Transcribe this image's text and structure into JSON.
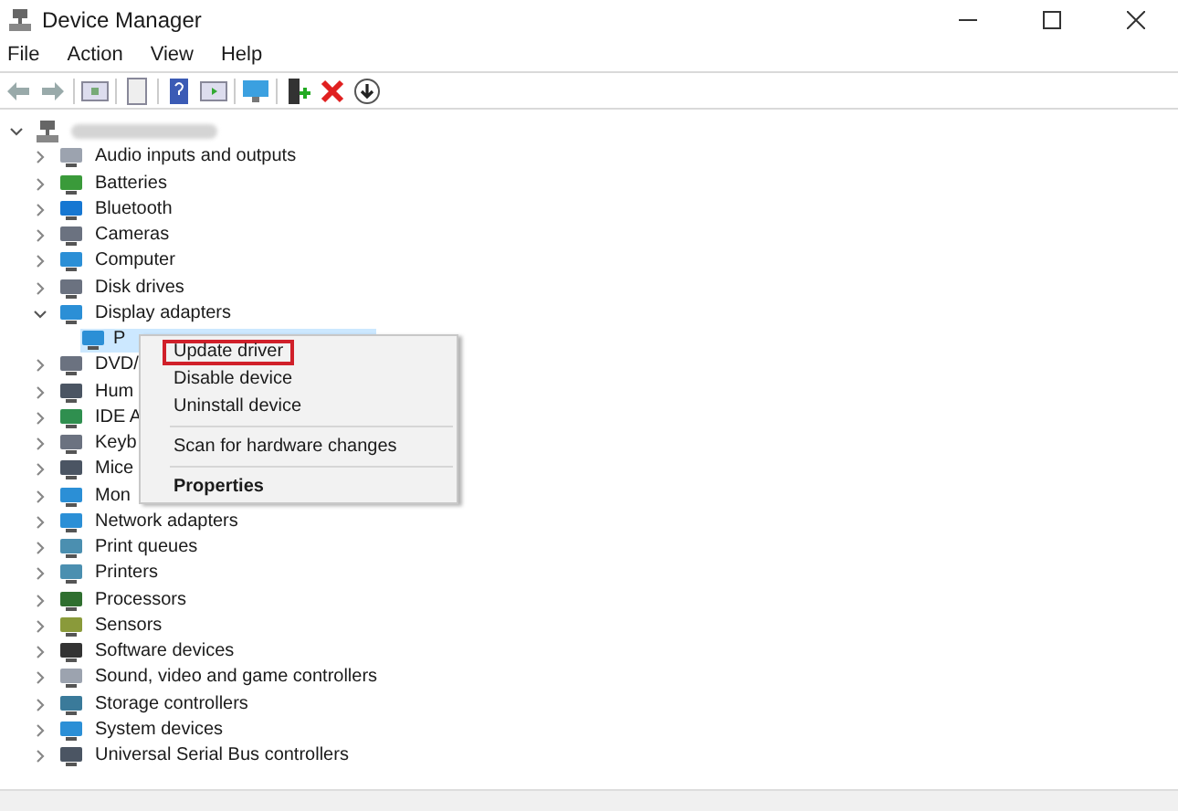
{
  "window": {
    "title": "Device Manager"
  },
  "menu_bar": [
    "File",
    "Action",
    "View",
    "Help"
  ],
  "tree": {
    "root": {
      "expanded": true
    },
    "children": [
      {
        "label": "Audio inputs and outputs",
        "expanded": false
      },
      {
        "label": "Batteries",
        "expanded": false
      },
      {
        "label": "Bluetooth",
        "expanded": false
      },
      {
        "label": "Cameras",
        "expanded": false
      },
      {
        "label": "Computer",
        "expanded": false
      },
      {
        "label": "Disk drives",
        "expanded": false
      },
      {
        "label": "Display adapters",
        "expanded": true,
        "children": [
          {
            "label": "P",
            "selected": true
          }
        ]
      },
      {
        "label": "DVD/",
        "expanded": false
      },
      {
        "label": "Hum",
        "expanded": false
      },
      {
        "label": "IDE A",
        "expanded": false
      },
      {
        "label": "Keyb",
        "expanded": false
      },
      {
        "label": "Mice",
        "expanded": false
      },
      {
        "label": "Mon",
        "expanded": false
      },
      {
        "label": "Network adapters",
        "expanded": false
      },
      {
        "label": "Print queues",
        "expanded": false
      },
      {
        "label": "Printers",
        "expanded": false
      },
      {
        "label": "Processors",
        "expanded": false
      },
      {
        "label": "Sensors",
        "expanded": false
      },
      {
        "label": "Software devices",
        "expanded": false
      },
      {
        "label": "Sound, video and game controllers",
        "expanded": false
      },
      {
        "label": "Storage controllers",
        "expanded": false
      },
      {
        "label": "System devices",
        "expanded": false
      },
      {
        "label": "Universal Serial Bus controllers",
        "expanded": false
      }
    ]
  },
  "context_menu": [
    {
      "kind": "item",
      "label": "Update driver",
      "selected": true,
      "bold": false
    },
    {
      "kind": "item",
      "label": "Disable device",
      "selected": false,
      "bold": false
    },
    {
      "kind": "item",
      "label": "Uninstall device",
      "selected": false,
      "bold": false
    },
    {
      "kind": "separator"
    },
    {
      "kind": "item",
      "label": "Scan for hardware changes",
      "selected": false,
      "bold": false
    },
    {
      "kind": "separator"
    },
    {
      "kind": "item",
      "label": "Properties",
      "selected": false,
      "bold": true
    }
  ]
}
